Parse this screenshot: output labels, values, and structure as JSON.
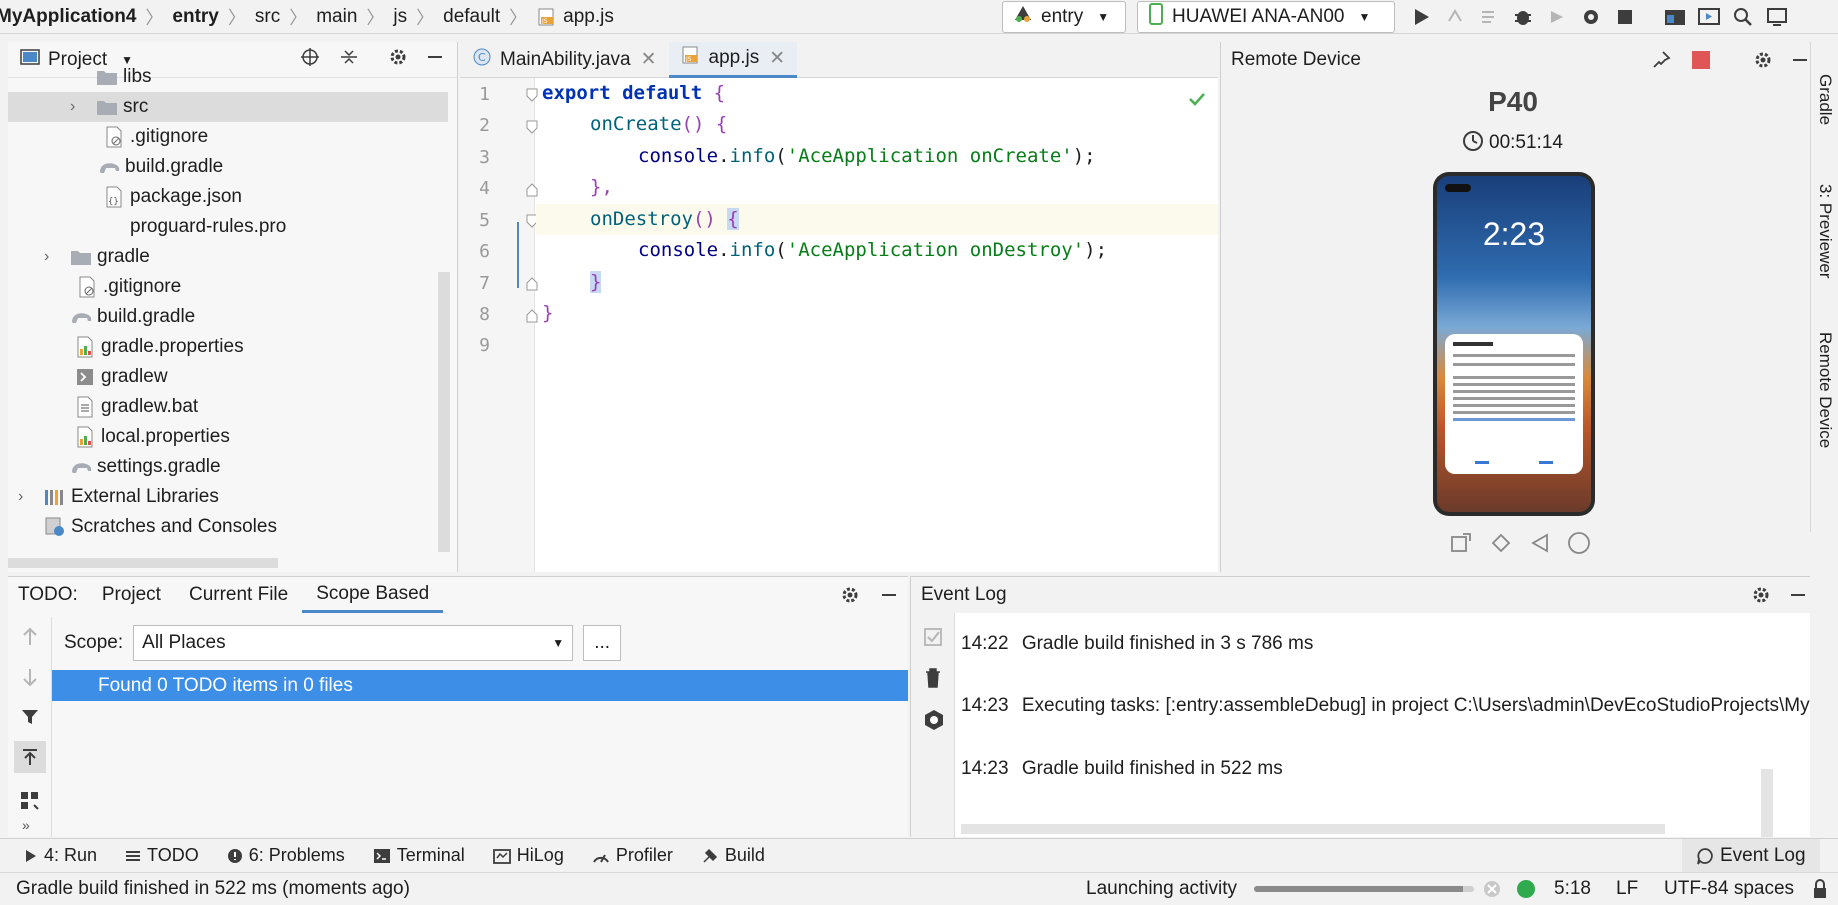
{
  "breadcrumb": [
    "MyApplication4",
    "entry",
    "src",
    "main",
    "js",
    "default",
    "app.js"
  ],
  "toolbar": {
    "run_config": "entry",
    "device": "HUAWEI ANA-AN00"
  },
  "project_panel": {
    "title": "Project",
    "items": [
      {
        "label": "libs",
        "icon": "folder-icon"
      },
      {
        "label": "src",
        "icon": "folder-icon"
      },
      {
        "label": ".gitignore",
        "icon": "gitignore-icon"
      },
      {
        "label": "build.gradle",
        "icon": "gradle-icon"
      },
      {
        "label": "package.json",
        "icon": "json-icon"
      },
      {
        "label": "proguard-rules.pro",
        "icon": "file-icon"
      },
      {
        "label": "gradle",
        "icon": "folder-icon"
      },
      {
        "label": ".gitignore",
        "icon": "gitignore-icon"
      },
      {
        "label": "build.gradle",
        "icon": "gradle-icon"
      },
      {
        "label": "gradle.properties",
        "icon": "properties-icon"
      },
      {
        "label": "gradlew",
        "icon": "terminal-file-icon"
      },
      {
        "label": "gradlew.bat",
        "icon": "file-icon"
      },
      {
        "label": "local.properties",
        "icon": "properties-icon"
      },
      {
        "label": "settings.gradle",
        "icon": "gradle-icon"
      },
      {
        "label": "External Libraries",
        "icon": "library-icon"
      },
      {
        "label": "Scratches and Consoles",
        "icon": "scratches-icon"
      }
    ]
  },
  "editor": {
    "tabs": [
      {
        "label": "MainAbility.java"
      },
      {
        "label": "app.js"
      }
    ],
    "line_numbers": [
      "1",
      "2",
      "3",
      "4",
      "5",
      "6",
      "7",
      "8",
      "9"
    ],
    "code": {
      "l1_kw": "export default",
      "l1_brace": "{",
      "l2_fn": "onCreate",
      "l2_paren": "() {",
      "l3_obj": "console",
      "l3_dot": ".",
      "l3_fn": "info",
      "l3_open": "(",
      "l3_str": "'AceApplication onCreate'",
      "l3_close": ");",
      "l4": "},",
      "l5_fn": "onDestroy",
      "l5_paren": "()",
      "l5_brace": "{",
      "l6_obj": "console",
      "l6_dot": ".",
      "l6_fn": "info",
      "l6_open": "(",
      "l6_str": "'AceApplication onDestroy'",
      "l6_close": ");",
      "l7": "}",
      "l8": "}"
    }
  },
  "remote_device": {
    "title": "Remote Device",
    "model": "P40",
    "timer": "00:51:14",
    "phone_time": "2:23"
  },
  "side_tabs": [
    "Gradle",
    "3: Previewer",
    "Remote Device"
  ],
  "todo": {
    "label": "TODO:",
    "tabs": [
      "Project",
      "Current File",
      "Scope Based"
    ],
    "scope_label": "Scope:",
    "scope_value": "All Places",
    "browse_label": "...",
    "result": "Found 0 TODO items in 0 files"
  },
  "event_log": {
    "title": "Event Log",
    "entries": [
      {
        "time": "14:22",
        "text": "Gradle build finished in 3 s 786 ms"
      },
      {
        "time": "14:23",
        "text": "Executing tasks: [:entry:assembleDebug] in project C:\\Users\\admin\\DevEcoStudioProjects\\My"
      },
      {
        "time": "14:23",
        "text": "Gradle build finished in 522 ms"
      }
    ]
  },
  "tool_strip": {
    "run": "4: Run",
    "todo": "TODO",
    "problems": "6: Problems",
    "terminal": "Terminal",
    "hilog": "HiLog",
    "profiler": "Profiler",
    "build": "Build",
    "event_log": "Event Log"
  },
  "status": {
    "message": "Gradle build finished in 522 ms (moments ago)",
    "activity": "Launching activity",
    "activity_progress": 0.95,
    "position": "5:18",
    "line_sep": "LF",
    "encoding": "UTF-8",
    "indent": "4 spaces"
  }
}
